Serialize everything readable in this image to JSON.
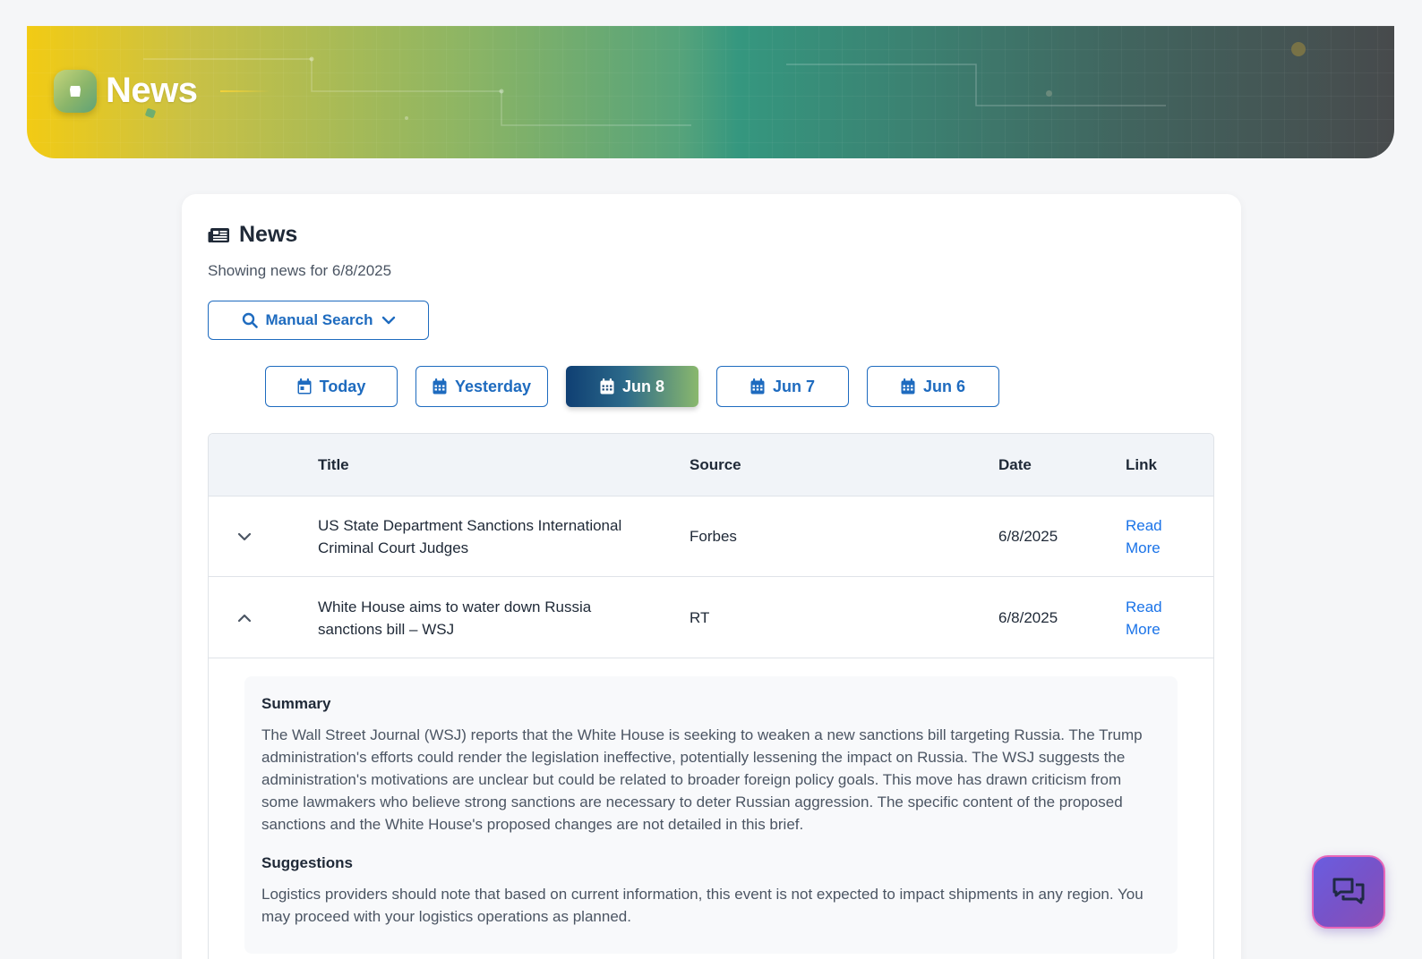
{
  "banner": {
    "title": "News"
  },
  "card": {
    "title": "News",
    "subtitle": "Showing news for 6/8/2025",
    "manual_search_label": "Manual Search"
  },
  "date_filters": [
    {
      "label": "Today",
      "active": false
    },
    {
      "label": "Yesterday",
      "active": false
    },
    {
      "label": "Jun 8",
      "active": true
    },
    {
      "label": "Jun 7",
      "active": false
    },
    {
      "label": "Jun 6",
      "active": false
    }
  ],
  "table": {
    "columns": [
      "Title",
      "Source",
      "Date",
      "Link"
    ],
    "rows": [
      {
        "title": "US State Department Sanctions International Criminal Court Judges",
        "source": "Forbes",
        "date": "6/8/2025",
        "link": "Read More",
        "expanded": false
      },
      {
        "title": "White House aims to water down Russia sanctions bill – WSJ",
        "source": "RT",
        "date": "6/8/2025",
        "link": "Read More",
        "expanded": true
      }
    ]
  },
  "details": {
    "summary_heading": "Summary",
    "summary_text": "The Wall Street Journal (WSJ) reports that the White House is seeking to weaken a new sanctions bill targeting Russia. The Trump administration's efforts could render the legislation ineffective, potentially lessening the impact on Russia. The WSJ suggests the administration's motivations are unclear but could be related to broader foreign policy goals. This move has drawn criticism from some lawmakers who believe strong sanctions are necessary to deter Russian aggression. The specific content of the proposed sanctions and the White House's proposed changes are not detailed in this brief.",
    "suggestions_heading": "Suggestions",
    "suggestions_text": "Logistics providers should note that based on current information, this event is not expected to impact shipments in any region. You may proceed with your logistics operations as planned."
  },
  "colors": {
    "accent": "#1e6bbf",
    "link": "#1a73e8",
    "banner_start": "#f2cb14",
    "banner_mid": "#35977f",
    "banner_end": "#474a4c"
  },
  "icons": {
    "banner_logo": "shield-icon",
    "card_header": "newspaper-icon",
    "search": "search-icon",
    "dropdown": "chevron-down-icon",
    "date": "calendar-icon",
    "row_collapsed": "chevron-down-icon",
    "row_expanded": "chevron-up-icon",
    "chat": "chat-icon"
  }
}
